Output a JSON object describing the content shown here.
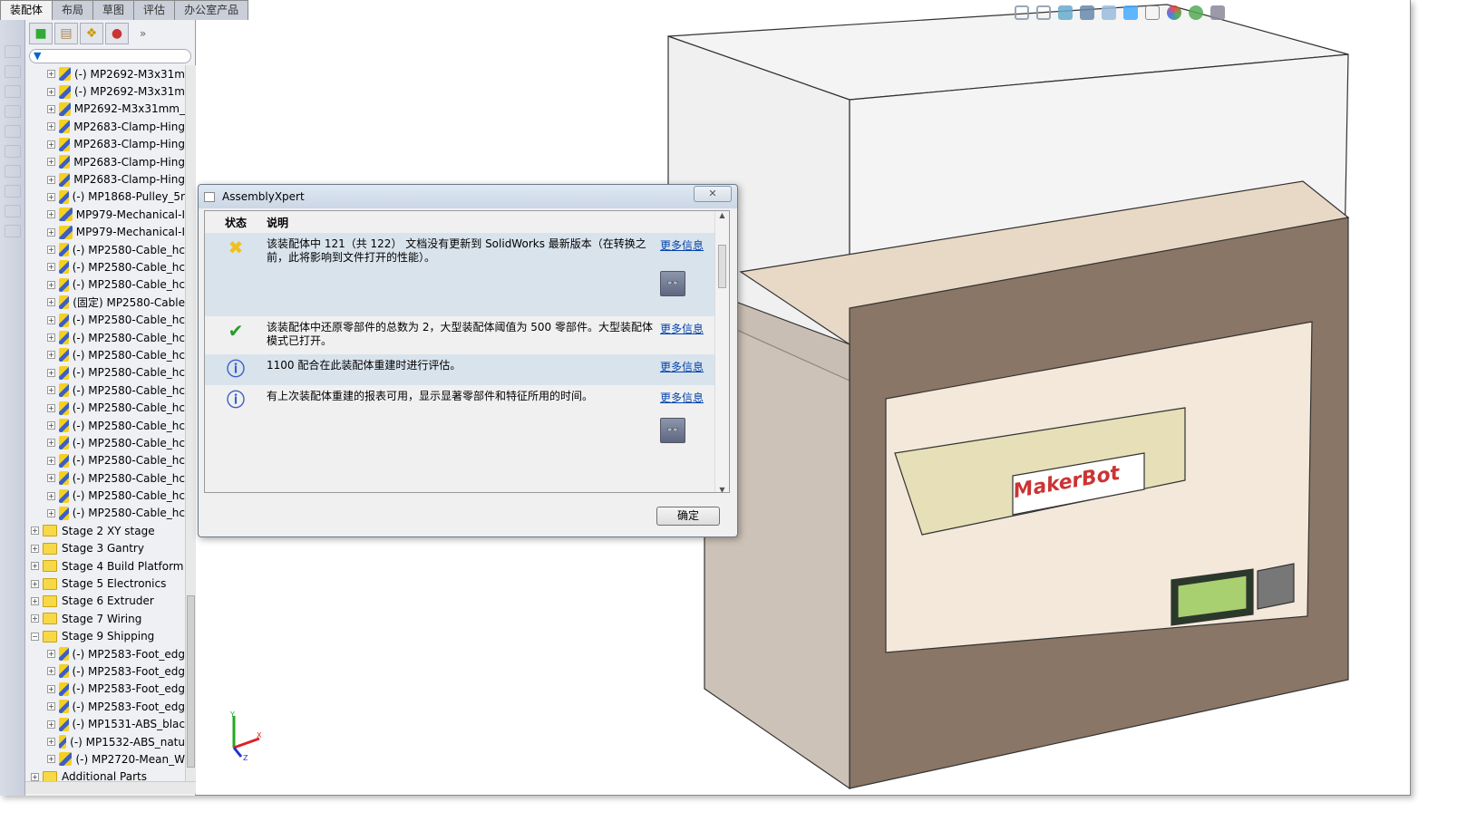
{
  "tabs": [
    {
      "label": "装配体",
      "active": true
    },
    {
      "label": "布局"
    },
    {
      "label": "草图"
    },
    {
      "label": "评估"
    },
    {
      "label": "办公室产品"
    }
  ],
  "feature_manager": {
    "more_tabs": "»",
    "tree": [
      {
        "type": "part",
        "label": "(-) MP2692-M3x31m"
      },
      {
        "type": "part",
        "label": "(-) MP2692-M3x31m"
      },
      {
        "type": "part",
        "label": "MP2692-M3x31mm_"
      },
      {
        "type": "part",
        "label": "MP2683-Clamp-Hing"
      },
      {
        "type": "part",
        "label": "MP2683-Clamp-Hing"
      },
      {
        "type": "part",
        "label": "MP2683-Clamp-Hing"
      },
      {
        "type": "part",
        "label": "MP2683-Clamp-Hing"
      },
      {
        "type": "part",
        "label": "(-) MP1868-Pulley_5r"
      },
      {
        "type": "part",
        "label": "MP979-Mechanical-I"
      },
      {
        "type": "part",
        "label": "MP979-Mechanical-I"
      },
      {
        "type": "part",
        "label": "(-) MP2580-Cable_hc"
      },
      {
        "type": "part",
        "label": "(-) MP2580-Cable_hc"
      },
      {
        "type": "part",
        "label": "(-) MP2580-Cable_hc"
      },
      {
        "type": "part",
        "label": "(固定) MP2580-Cable"
      },
      {
        "type": "part",
        "label": "(-) MP2580-Cable_hc"
      },
      {
        "type": "part",
        "label": "(-) MP2580-Cable_hc"
      },
      {
        "type": "part",
        "label": "(-) MP2580-Cable_hc"
      },
      {
        "type": "part",
        "label": "(-) MP2580-Cable_hc"
      },
      {
        "type": "part",
        "label": "(-) MP2580-Cable_hc"
      },
      {
        "type": "part",
        "label": "(-) MP2580-Cable_hc"
      },
      {
        "type": "part",
        "label": "(-) MP2580-Cable_hc"
      },
      {
        "type": "part",
        "label": "(-) MP2580-Cable_hc"
      },
      {
        "type": "part",
        "label": "(-) MP2580-Cable_hc"
      },
      {
        "type": "part",
        "label": "(-) MP2580-Cable_hc"
      },
      {
        "type": "part",
        "label": "(-) MP2580-Cable_hc"
      },
      {
        "type": "part",
        "label": "(-) MP2580-Cable_hc"
      },
      {
        "type": "folder",
        "label": "Stage 2 XY stage"
      },
      {
        "type": "folder",
        "label": "Stage 3 Gantry"
      },
      {
        "type": "folder",
        "label": "Stage 4 Build Platform"
      },
      {
        "type": "folder",
        "label": "Stage 5 Electronics"
      },
      {
        "type": "folder",
        "label": "Stage 6 Extruder"
      },
      {
        "type": "folder",
        "label": "Stage 7 Wiring"
      },
      {
        "type": "folder",
        "label": "Stage 9 Shipping",
        "expanded": true
      },
      {
        "type": "part",
        "label": "(-) MP2583-Foot_edg"
      },
      {
        "type": "part",
        "label": "(-) MP2583-Foot_edg"
      },
      {
        "type": "part",
        "label": "(-) MP2583-Foot_edg"
      },
      {
        "type": "part",
        "label": "(-) MP2583-Foot_edg"
      },
      {
        "type": "part",
        "label": "(-) MP1531-ABS_blac"
      },
      {
        "type": "part",
        "label": "(-) MP1532-ABS_natu"
      },
      {
        "type": "part",
        "label": "(-) MP2720-Mean_W"
      },
      {
        "type": "folder",
        "label": "Additional Parts"
      }
    ]
  },
  "dialog": {
    "title": "AssemblyXpert",
    "close": "✕",
    "col_status": "状态",
    "col_desc": "说明",
    "items": [
      {
        "status": "warning",
        "desc": "该装配体中 121（共 122） 文档没有更新到 SolidWorks 最新版本（在转换之前，此将影响到文件打开的性能）。",
        "link": "更多信息",
        "has_view": true
      },
      {
        "status": "ok",
        "desc": "该装配体中还原零部件的总数为 2，大型装配体阈值为 500 零部件。大型装配体模式已打开。",
        "link": "更多信息"
      },
      {
        "status": "info",
        "desc": "1100 配合在此装配体重建时进行评估。",
        "link": "更多信息"
      },
      {
        "status": "info",
        "desc": "有上次装配体重建的报表可用，显示显著零部件和特征所用的时间。",
        "link": "更多信息",
        "has_view": true
      }
    ],
    "ok": "确定"
  },
  "model": {
    "logo": "MakerBot"
  },
  "triad": {
    "x": "X",
    "y": "Y",
    "z": "Z"
  },
  "colors": {
    "warning": "#f0c020",
    "ok": "#2a9a2a",
    "info": "#3a5fc8",
    "link": "#0645ad",
    "panel": "#8a7666"
  }
}
